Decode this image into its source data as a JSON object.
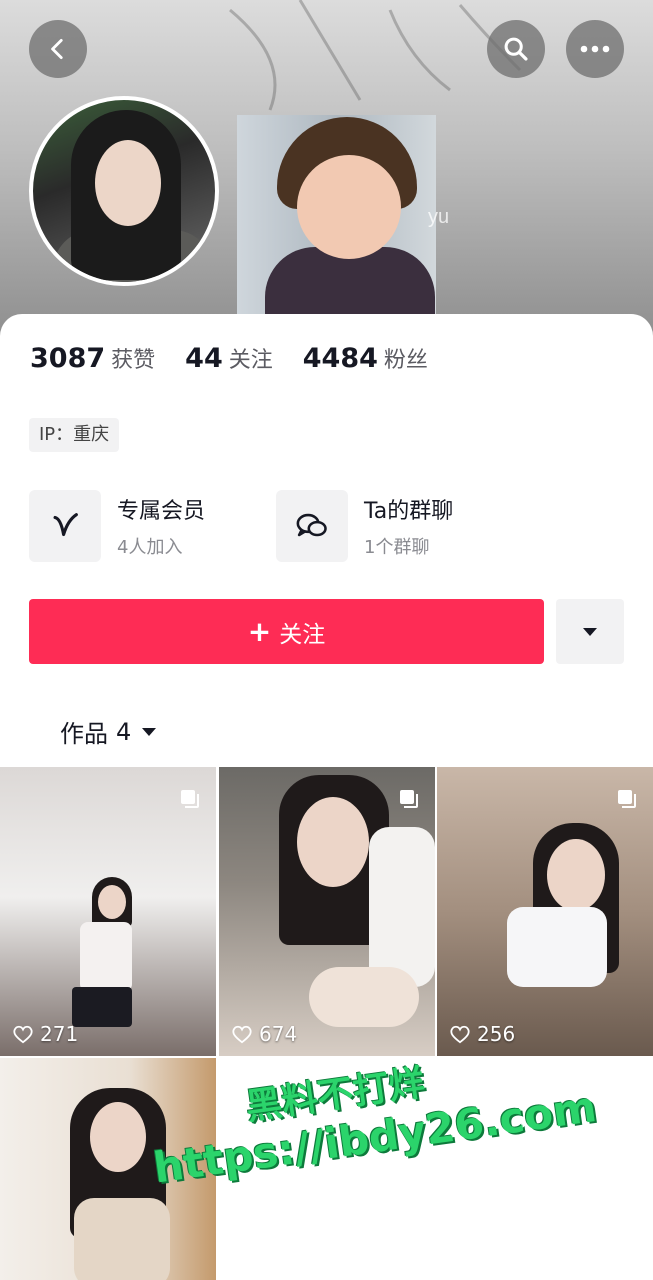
{
  "header": {
    "username_fragment": "yu"
  },
  "stats": [
    {
      "num": "3087",
      "label": "获赞"
    },
    {
      "num": "44",
      "label": "关注"
    },
    {
      "num": "4484",
      "label": "粉丝"
    }
  ],
  "ip": "IP：重庆",
  "features": {
    "member": {
      "title": "专属会员",
      "sub": "4人加入",
      "icon": "v-member-icon"
    },
    "group": {
      "title": "Ta的群聊",
      "sub": "1个群聊",
      "icon": "chat-bubbles-icon"
    }
  },
  "follow": {
    "plus": "+",
    "label": "关注"
  },
  "works": {
    "label": "作品",
    "count": "4"
  },
  "videos": [
    {
      "likes": "271"
    },
    {
      "likes": "674"
    },
    {
      "likes": "256"
    },
    {
      "likes": ""
    }
  ],
  "promo": {
    "line1": "黑料不打烊",
    "line2": "https://ibdy26.com"
  },
  "colors": {
    "accent": "#fe2c55",
    "promo": "#2bd46b"
  }
}
